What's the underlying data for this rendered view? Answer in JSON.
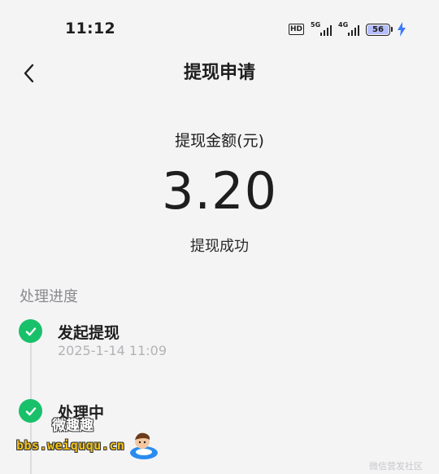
{
  "status_bar": {
    "time": "11:12",
    "hd_label": "HD",
    "network1_label": "5G",
    "network2_label": "4G",
    "battery_level": "56"
  },
  "header": {
    "title": "提现申请"
  },
  "summary": {
    "amount_label": "提现金额(元)",
    "amount": "3.20",
    "status": "提现成功"
  },
  "progress": {
    "title": "处理进度",
    "steps": [
      {
        "title": "发起提现",
        "time": "2025-1-14 11:09"
      },
      {
        "title": "处理中",
        "time": ""
      }
    ]
  },
  "watermark": {
    "title": "微趣趣",
    "site": "bbs.weiququ.cn",
    "corner": "微信营发社区"
  },
  "colors": {
    "background": "#f4f4f5",
    "success_green": "#19c06a",
    "muted_text": "#8a8a8e",
    "battery_fill": "#b6bdfc"
  }
}
